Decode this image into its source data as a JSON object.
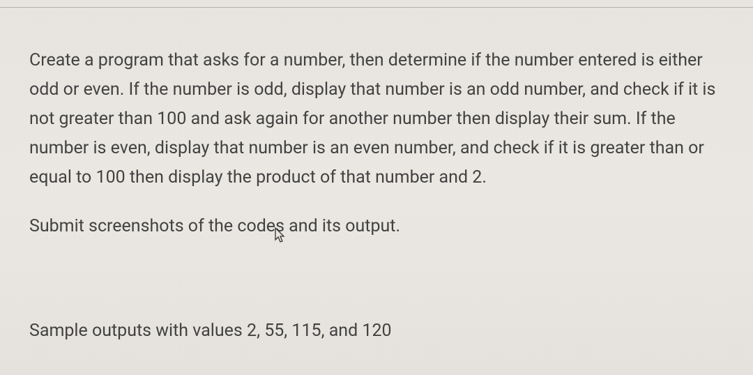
{
  "document": {
    "paragraph1": "Create a program that asks for a number, then determine if the number entered is either odd or even. If the number is odd, display that number is an odd number, and check if it is not greater than 100 and ask again for another number then display their sum. If the number is even, display that number is an even number, and check if it is greater than or equal to 100 then display the product of that number and 2.",
    "paragraph2": "Submit screenshots of the codes and its output.",
    "paragraph3": "Sample outputs with values 2, 55, 115, and 120"
  }
}
